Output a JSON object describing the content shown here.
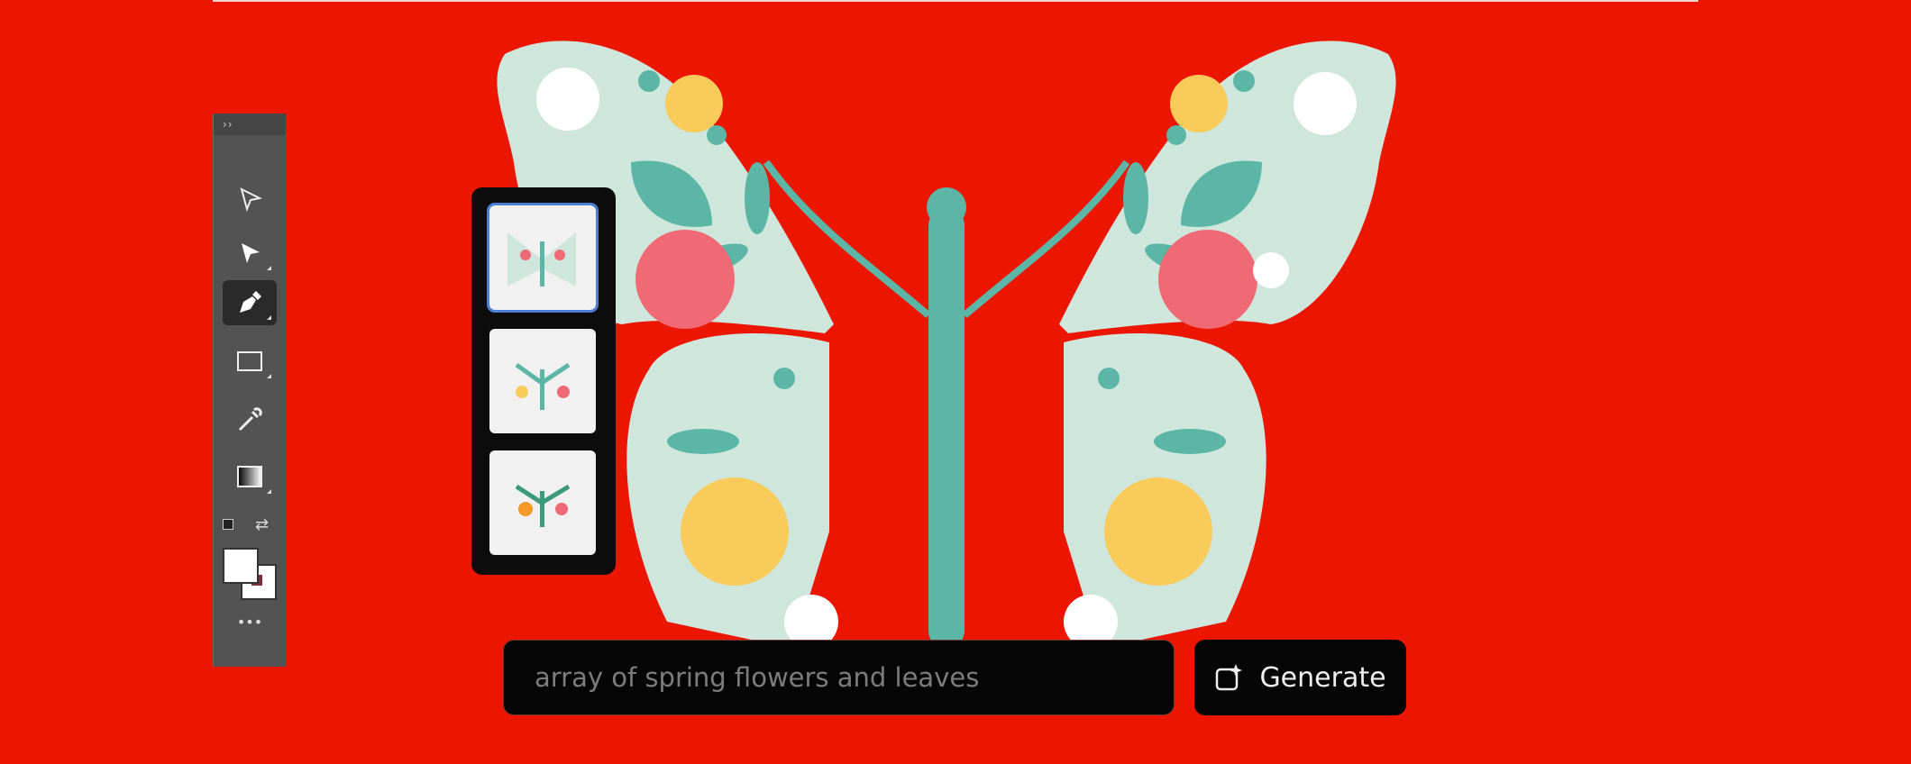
{
  "toolbar": {
    "collapse_label": "››",
    "tools": [
      {
        "name": "selection-tool",
        "icon": "arrow-outline-icon"
      },
      {
        "name": "direct-selection-tool",
        "icon": "arrow-filled-icon"
      },
      {
        "name": "pen-tool",
        "icon": "pen-icon",
        "active": true
      },
      {
        "name": "rectangle-tool",
        "icon": "rectangle-icon"
      },
      {
        "name": "eyedropper-tool",
        "icon": "eyedropper-icon"
      },
      {
        "name": "gradient-tool",
        "icon": "gradient-icon"
      }
    ],
    "more_label": "•••"
  },
  "prompt": {
    "value": "array of spring flowers and leaves"
  },
  "generate": {
    "label": "Generate",
    "icon": "generative-fill-icon"
  },
  "colors": {
    "background": "#ec1500",
    "butterfly": "#cfe6dc",
    "teal": "#5bb6a6",
    "pink": "#ef6a74",
    "yellow": "#f8cb5a"
  }
}
